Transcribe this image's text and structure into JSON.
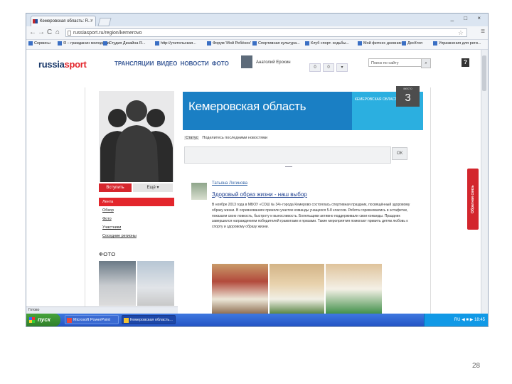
{
  "browser": {
    "tab_title": "Кемеровская область: R...",
    "tab_close": "×",
    "window_controls": "_ □ ×",
    "back": "←",
    "forward": "→",
    "reload": "C",
    "home": "⌂",
    "url": "russiasport.ru/region/kemerovo",
    "star": "☆",
    "menu": "≡",
    "bookmarks": [
      "Сервисы",
      "Я – гражданин молодёжи",
      "Студия Дизайна R...",
      "http://учительская...",
      "Форум 'Мой Ребёнок'",
      "Спортивная культура...",
      "Клуб спорт. ходьбы...",
      "Мой фитнес дневник",
      "ДесКтоп",
      "Упражнения для реги..."
    ]
  },
  "site": {
    "logo_main": "russia",
    "logo_accent": "sport",
    "nav": "ТРАНСЛЯЦИИ ВИДЕО НОВОСТИ ФОТО",
    "username": "Анатолий Ерохин",
    "header_buttons": [
      "0",
      "0",
      "▾"
    ],
    "search_placeholder": "Поиск по сайту",
    "search_button": "⌕",
    "help": "?"
  },
  "profile": {
    "join_button": "Вступить",
    "more_button": "Ещё ▾",
    "menu": [
      "Лента",
      "Обзор",
      "Фото",
      "Участники",
      "Соседние регионы"
    ],
    "foto_title": "ФОТО"
  },
  "banner": {
    "title": "Кемеровская область",
    "subtitle": "КЕМЕРОВСКАЯ ОБЛАСТЬ",
    "badge_label": "место",
    "badge_number": "3"
  },
  "feed": {
    "status_tag": "Статус",
    "status_text": "Поделитесь последними новостями",
    "post_button": "ОК",
    "post": {
      "author": "Татьяна Логинова",
      "title": "Здоровый образ жизни - наш выбор",
      "body": "В ноябре 2013 года в МБОУ «СОШ № 34» города Кемерово состоялась спортивная праздник, посвящённый здоровому образу жизни. В соревнованиях приняли участие команды учащихся 5-8 классов. Ребята соревновались в эстафетах, показали свою ловкость, быстроту и выносливость. Болельщики активно поддерживали свои команды. Праздник завершился награждением победителей грамотами и призами. Такие мероприятия помогают привить детям любовь к спорту и здоровому образу жизни."
    }
  },
  "feedback_label": "Обратная связь",
  "statusbar": "Готово",
  "taskbar": {
    "start": "пуск",
    "tasks": [
      "Microsoft PowerPoint",
      "Кемеровская область..."
    ],
    "clock": "RU  ◀ ■ ▶  18:45"
  },
  "page_number": "28"
}
